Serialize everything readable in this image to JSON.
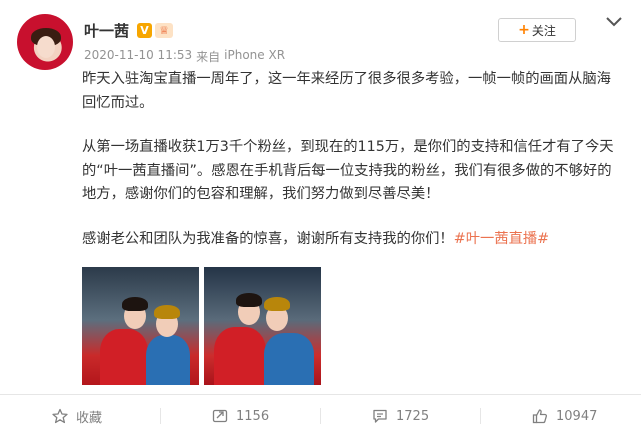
{
  "user": {
    "name": "叶一茜",
    "vip_badge": "V",
    "crown_badge": "♕"
  },
  "meta": {
    "datetime": "2020-11-10 11:53",
    "from_label": "来自",
    "device": "iPhone XR"
  },
  "follow_button": {
    "plus": "+",
    "label": "关注"
  },
  "post": {
    "paragraph1": "昨天入驻淘宝直播一周年了，这一年来经历了很多很多考验，一帧一帧的画面从脑海回忆而过。",
    "paragraph2": "从第一场直播收获1万3千个粉丝，到现在的115万，是你们的支持和信任才有了今天的“叶一茜直播间”。感恩在手机背后每一位支持我的粉丝，我们有很多做的不够好的地方，感谢你们的包容和理解，我们努力做到尽善尽美！",
    "paragraph3_text": "感谢老公和团队为我准备的惊喜，谢谢所有支持我的你们！",
    "hashtag": "#叶一茜直播#"
  },
  "actions": {
    "favorite_label": "收藏",
    "repost_count": "1156",
    "comment_count": "1725",
    "like_count": "10947"
  },
  "colors": {
    "accent_orange": "#ff8200",
    "hashtag": "#eb7350",
    "muted_text": "#939393",
    "vip_gold": "#f7a600"
  },
  "icons": [
    "avatar",
    "vip-badge",
    "crown-badge",
    "chevron-down-icon",
    "star-icon",
    "repost-icon",
    "comment-icon",
    "thumbs-up-icon"
  ]
}
